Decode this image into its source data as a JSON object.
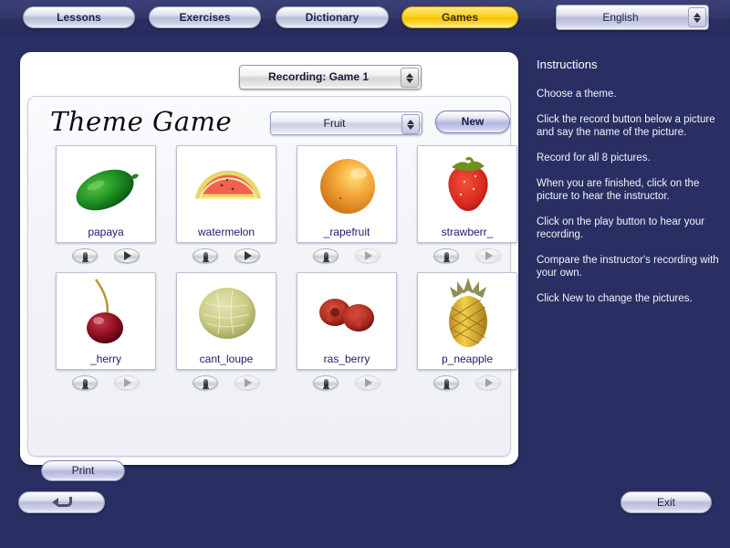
{
  "colors": {
    "background": "#2a2f63",
    "active_tab": "#ffd42a",
    "panel": "#ffffff",
    "label_text": "#1c1c6e"
  },
  "topbar": {
    "tabs": [
      {
        "label": "Lessons",
        "active": false
      },
      {
        "label": "Exercises",
        "active": false
      },
      {
        "label": "Dictionary",
        "active": false
      },
      {
        "label": "Games",
        "active": true
      }
    ],
    "language_select": {
      "value": "English"
    }
  },
  "main": {
    "recording_select": {
      "value": "Recording: Game 1"
    },
    "theme_title": "Theme Game",
    "theme_select": {
      "value": "Fruit"
    },
    "new_button": "New",
    "print_button": "Print",
    "pictures": [
      {
        "label": "papaya",
        "art": "papaya",
        "record_enabled": true,
        "play_enabled": true
      },
      {
        "label": "watermelon",
        "art": "watermelon",
        "record_enabled": true,
        "play_enabled": true
      },
      {
        "label": "_rapefruit",
        "art": "grapefruit",
        "record_enabled": true,
        "play_enabled": false
      },
      {
        "label": "strawberr_",
        "art": "strawberry",
        "record_enabled": true,
        "play_enabled": false
      },
      {
        "label": "_herry",
        "art": "cherry",
        "record_enabled": true,
        "play_enabled": false
      },
      {
        "label": "cant_loupe",
        "art": "cantaloupe",
        "record_enabled": true,
        "play_enabled": false
      },
      {
        "label": "ras_berry",
        "art": "raspberry",
        "record_enabled": true,
        "play_enabled": false
      },
      {
        "label": "p_neapple",
        "art": "pineapple",
        "record_enabled": true,
        "play_enabled": false
      }
    ]
  },
  "instructions": {
    "title": "Instructions",
    "lines": [
      "Choose a theme.",
      "Click the record button below a picture and say the name of the picture.",
      "Record for all 8 pictures.",
      "When you are finished, click on the picture to hear the instructor.",
      "Click on the play button to hear your recording.",
      "Compare the instructor's recording with your own.",
      "Click New to change the pictures."
    ]
  },
  "footer": {
    "back_button": "back-arrow",
    "exit_button": "Exit"
  }
}
